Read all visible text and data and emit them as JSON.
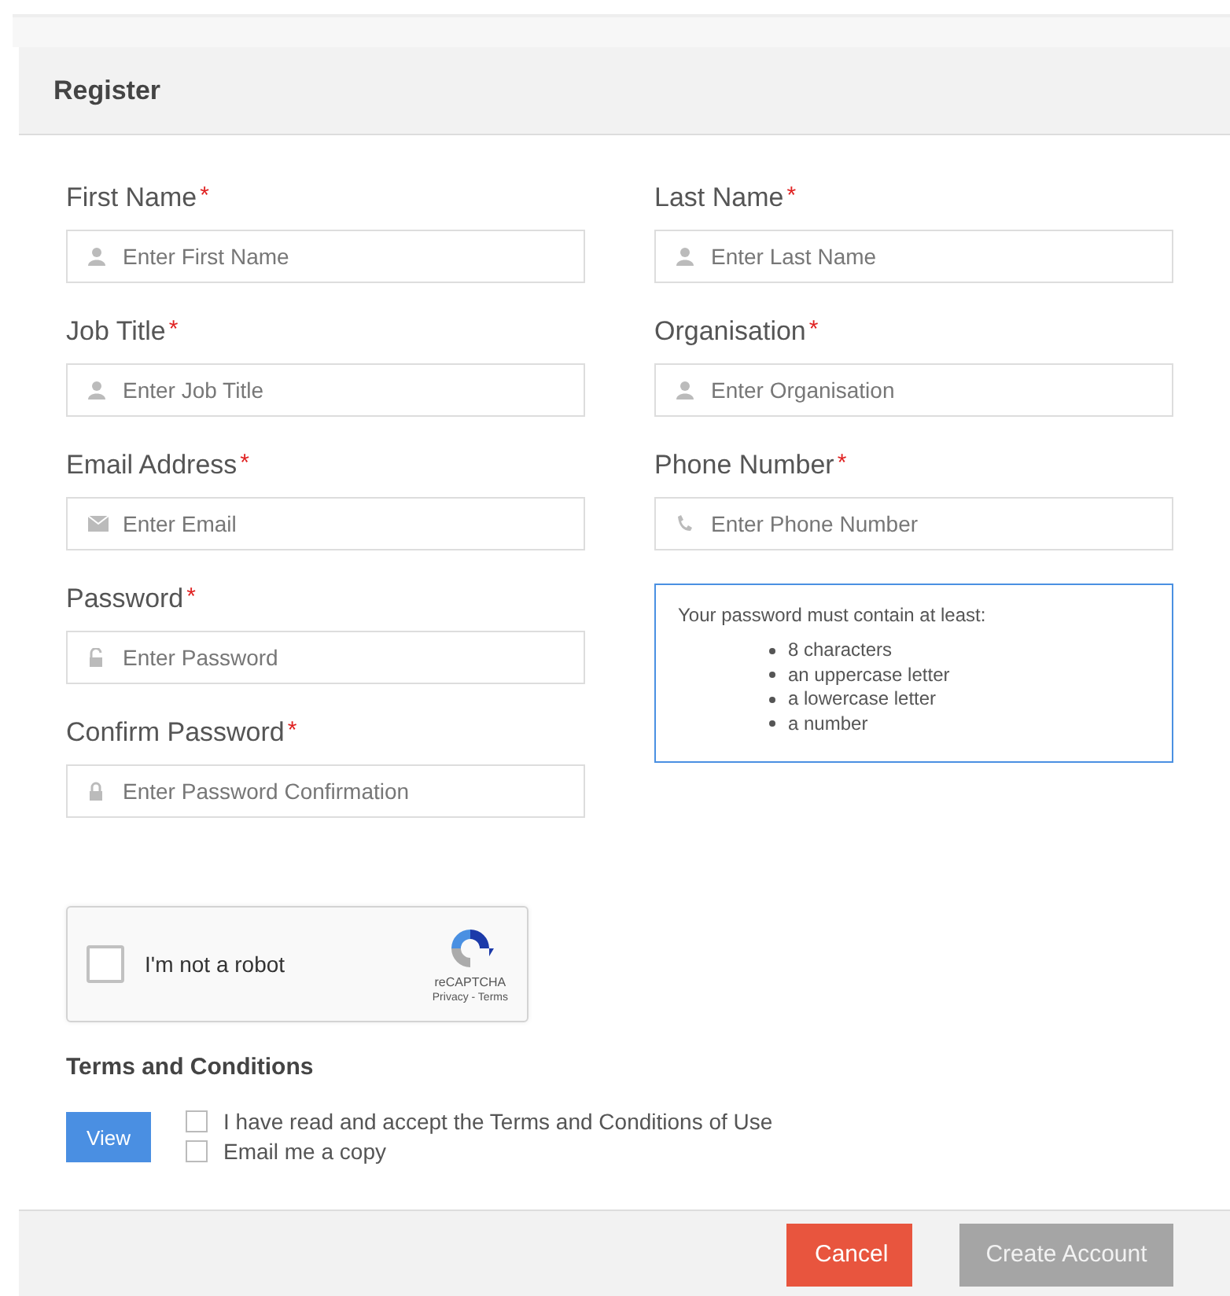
{
  "panel": {
    "title": "Register"
  },
  "left_fields": [
    {
      "label": "First Name",
      "required_mark": "*",
      "placeholder": "Enter First Name",
      "kind": "person"
    },
    {
      "label": "Job Title",
      "required_mark": "*",
      "placeholder": "Enter Job Title",
      "kind": "person"
    },
    {
      "label": "Email Address",
      "required_mark": "*",
      "placeholder": "Enter Email",
      "kind": "email"
    },
    {
      "label": "Password",
      "required_mark": "*",
      "placeholder": "Enter Password",
      "kind": "password"
    },
    {
      "label": "Confirm Password",
      "required_mark": "*",
      "placeholder": "Enter Password Confirmation",
      "kind": "confirm"
    }
  ],
  "right_fields": [
    {
      "label": "Last Name",
      "required_mark": "*",
      "placeholder": "Enter Last Name",
      "kind": "person"
    },
    {
      "label": "Organisation",
      "required_mark": "*",
      "placeholder": "Enter Organisation",
      "kind": "person"
    },
    {
      "label": "Phone Number",
      "required_mark": "*",
      "placeholder": "Enter Phone Number",
      "kind": "phone"
    }
  ],
  "password_rules": {
    "intro": "Your password must contain at least:",
    "items": [
      "8 characters",
      "an uppercase letter",
      "a lowercase letter",
      "a number"
    ]
  },
  "captcha": {
    "label": "I'm not a robot",
    "checked": false,
    "brand": "reCAPTCHA",
    "links": "Privacy - Terms"
  },
  "terms": {
    "heading": "Terms and Conditions",
    "view_button": "View",
    "options": [
      {
        "label": "I have read and accept the Terms and Conditions of Use",
        "checked": false
      },
      {
        "label": "Email me a copy",
        "checked": false
      }
    ]
  },
  "footer": {
    "buttons": [
      {
        "label": "Cancel",
        "kind": "danger"
      },
      {
        "label": "Create Account",
        "kind": "muted"
      }
    ]
  }
}
